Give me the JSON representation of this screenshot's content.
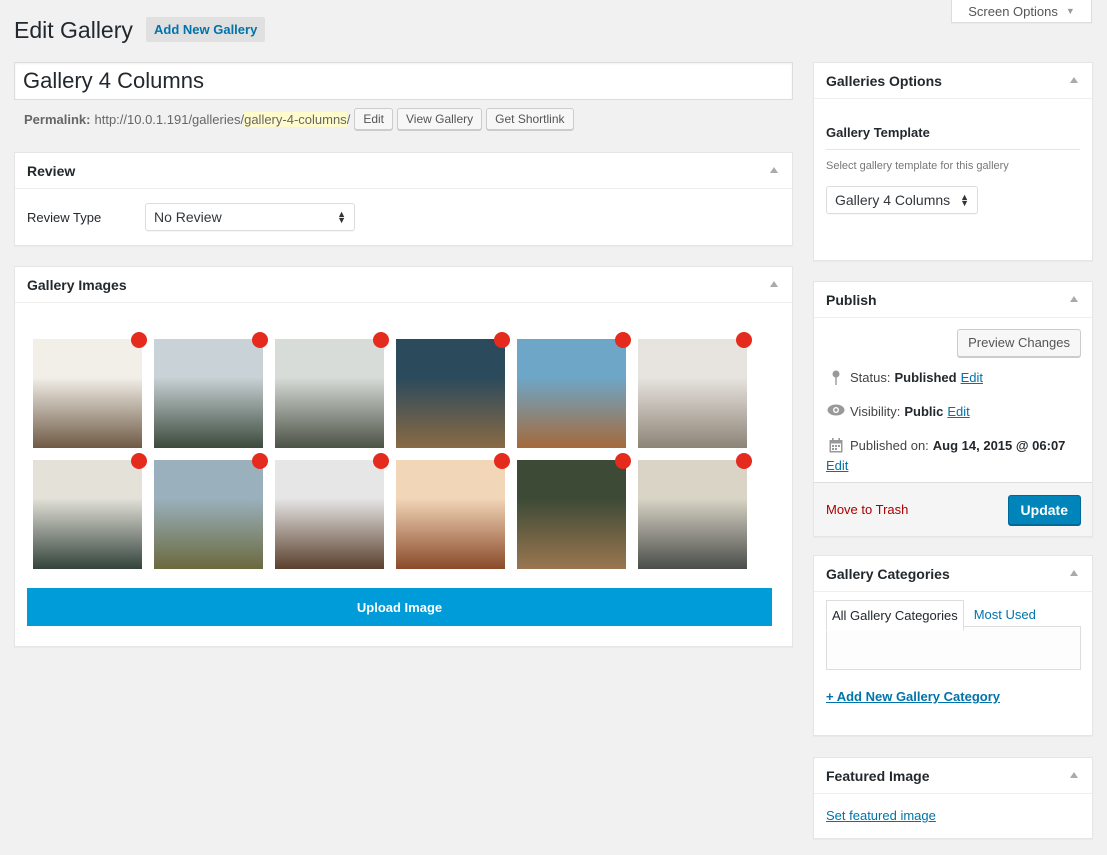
{
  "header": {
    "title": "Edit Gallery",
    "add_new_label": "Add New Gallery",
    "screen_options_label": "Screen Options"
  },
  "post": {
    "title": "Gallery 4 Columns",
    "permalink_label": "Permalink:",
    "permalink_base": "http://10.0.1.191/galleries/",
    "permalink_slug": "gallery-4-columns",
    "permalink_trailing": "/",
    "edit_label": "Edit",
    "view_label": "View Gallery",
    "shortlink_label": "Get Shortlink"
  },
  "review": {
    "title": "Review",
    "field_label": "Review Type",
    "selected": "No Review"
  },
  "gallery": {
    "title": "Gallery Images",
    "upload_label": "Upload Image",
    "images": [
      {
        "icon": "photo-lake-hikers-thumb",
        "color_a": "#f2efe9",
        "color_b": "#6e5a44"
      },
      {
        "icon": "photo-mountain-lake-thumb",
        "color_a": "#c9d2d6",
        "color_b": "#3b4a3c"
      },
      {
        "icon": "photo-boat-lake-thumb",
        "color_a": "#d8dcd8",
        "color_b": "#4b5246"
      },
      {
        "icon": "photo-dogs-car-thumb",
        "color_a": "#2b4a5c",
        "color_b": "#8a6a45"
      },
      {
        "icon": "photo-sailboat-thumb",
        "color_a": "#6ea6c8",
        "color_b": "#a46a3a"
      },
      {
        "icon": "photo-snow-deer-thumb",
        "color_a": "#e7e4df",
        "color_b": "#8d8477"
      },
      {
        "icon": "photo-foggy-forest-thumb",
        "color_a": "#e3e1d8",
        "color_b": "#33433b"
      },
      {
        "icon": "photo-mountain-road-thumb",
        "color_a": "#9ab0bd",
        "color_b": "#6b6a3e"
      },
      {
        "icon": "photo-snow-girl-thumb",
        "color_a": "#e6e6e6",
        "color_b": "#5a3f2c"
      },
      {
        "icon": "photo-girl-rocks-thumb",
        "color_a": "#f2d6b8",
        "color_b": "#8a4a2a"
      },
      {
        "icon": "photo-hiker-boots-thumb",
        "color_a": "#3c4a36",
        "color_b": "#9a7650"
      },
      {
        "icon": "photo-bicycle-girl-thumb",
        "color_a": "#d9d4c6",
        "color_b": "#4a4d4a"
      }
    ]
  },
  "sidebar": {
    "options": {
      "title": "Galleries Options",
      "template_label": "Gallery Template",
      "template_desc": "Select gallery template for this gallery",
      "template_selected": "Gallery 4 Columns"
    },
    "publish": {
      "title": "Publish",
      "preview_label": "Preview Changes",
      "status_label": "Status:",
      "status_value": "Published",
      "visibility_label": "Visibility:",
      "visibility_value": "Public",
      "published_label": "Published on:",
      "published_value": "Aug 14, 2015 @ 06:07",
      "edit_label": "Edit",
      "trash_label": "Move to Trash",
      "update_label": "Update"
    },
    "categories": {
      "title": "Gallery Categories",
      "tab_all": "All Gallery Categories",
      "tab_most": "Most Used",
      "add_label": "+ Add New Gallery Category"
    },
    "featured": {
      "title": "Featured Image",
      "set_label": "Set featured image"
    }
  },
  "colors": {
    "accent": "#0073aa",
    "upload_bg": "#009bd9",
    "update_bg": "#0085ba",
    "delete_dot": "#e52b1e",
    "trash": "#a00000"
  }
}
